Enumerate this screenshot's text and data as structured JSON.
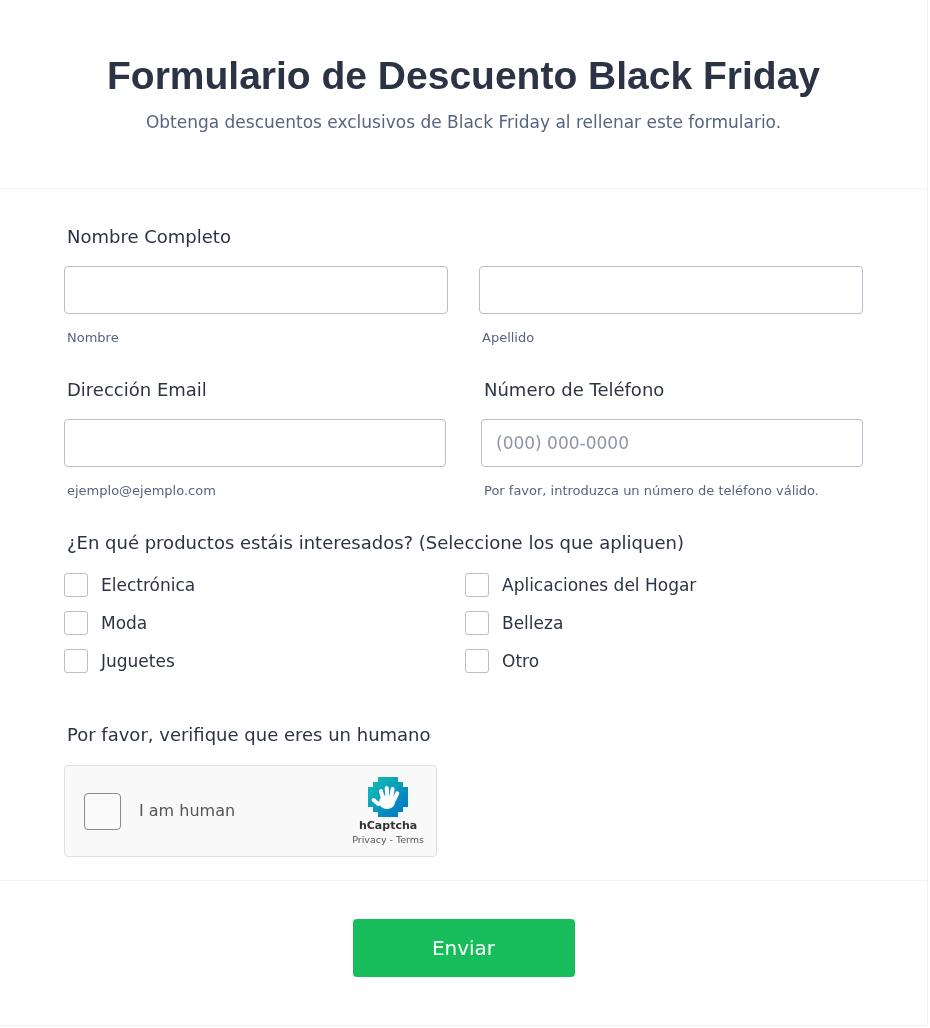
{
  "header": {
    "title": "Formulario de Descuento Black Friday",
    "subtitle": "Obtenga descuentos exclusivos de Black Friday al rellenar este formulario."
  },
  "full_name": {
    "label": "Nombre Completo",
    "inputs": [
      {
        "sublabel": "Nombre"
      },
      {
        "sublabel": "Apellido"
      }
    ]
  },
  "contact_fields": [
    {
      "label": "Dirección Email",
      "sublabel": "ejemplo@ejemplo.com"
    },
    {
      "label": "Número de Teléfono",
      "placeholder": "(000) 000-0000",
      "sublabel": "Por favor, introduzca un número de teléfono válido."
    }
  ],
  "products": {
    "question": "¿En qué productos estáis interesados? (Seleccione los que apliquen)",
    "options": [
      {
        "label": "Electrónica",
        "checked": false
      },
      {
        "label": "Aplicaciones del Hogar",
        "checked": false
      },
      {
        "label": "Moda",
        "checked": false
      },
      {
        "label": "Belleza",
        "checked": false
      },
      {
        "label": "Juguetes",
        "checked": false
      },
      {
        "label": "Otro",
        "checked": false
      }
    ]
  },
  "captcha": {
    "label": "Por favor, verifique que eres un humano",
    "checkbox_label": "I am human",
    "checked": false,
    "brand": "hCaptcha",
    "links": [
      "Privacy",
      "Terms"
    ],
    "separator": "-"
  },
  "submit": {
    "label": "Enviar"
  }
}
